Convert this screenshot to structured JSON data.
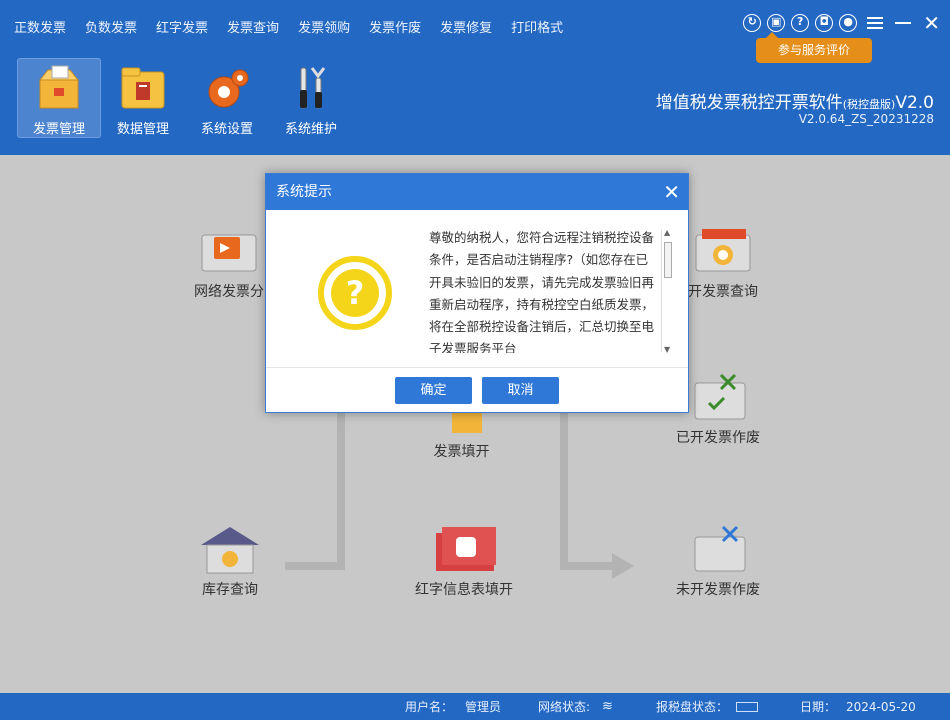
{
  "top_menu": [
    "正数发票",
    "负数发票",
    "红字发票",
    "发票查询",
    "发票领购",
    "发票作废",
    "发票修复",
    "打印格式"
  ],
  "eval_tip": "参与服务评价",
  "toolbar": [
    {
      "label": "发票管理",
      "icon": "invoice-box-icon",
      "active": true
    },
    {
      "label": "数据管理",
      "icon": "folder-icon",
      "active": false
    },
    {
      "label": "系统设置",
      "icon": "gear-icon",
      "active": false
    },
    {
      "label": "系统维护",
      "icon": "tools-icon",
      "active": false
    }
  ],
  "brand": {
    "title": "增值税发票税控开票软件",
    "edition": "(税控盘版)",
    "version_suffix": "V2.0",
    "build": "V2.0.64_ZS_20231228"
  },
  "workspace": {
    "nodes": {
      "network_dist": "网络发票分",
      "issued_query": "开发票查询",
      "invoice_fill": "发票填开",
      "issued_void": "已开发票作废",
      "stock_query": "库存查询",
      "red_info": "红字信息表填开",
      "unissued_void": "未开发票作废"
    }
  },
  "dialog": {
    "title": "系统提示",
    "message": "尊敬的纳税人，您符合远程注销税控设备条件，是否启动注销程序?（如您存在已开具未验旧的发票，请先完成发票验旧再重新启动程序，持有税控空白纸质发票，将在全部税控设备注销后，汇总切换至电子发票服务平台",
    "confirm": "确定",
    "cancel": "取消"
  },
  "statusbar": {
    "user_label": "用户名：",
    "user_value": "管理员",
    "network_label": "网络状态:",
    "disk_label": "报税盘状态：",
    "date_label": "日期：",
    "date_value": "2024-05-20"
  },
  "colors": {
    "header_bg": "#2368c2",
    "accent": "#2f78d8",
    "orange": "#e58f1a",
    "question": "#f4d51a"
  }
}
